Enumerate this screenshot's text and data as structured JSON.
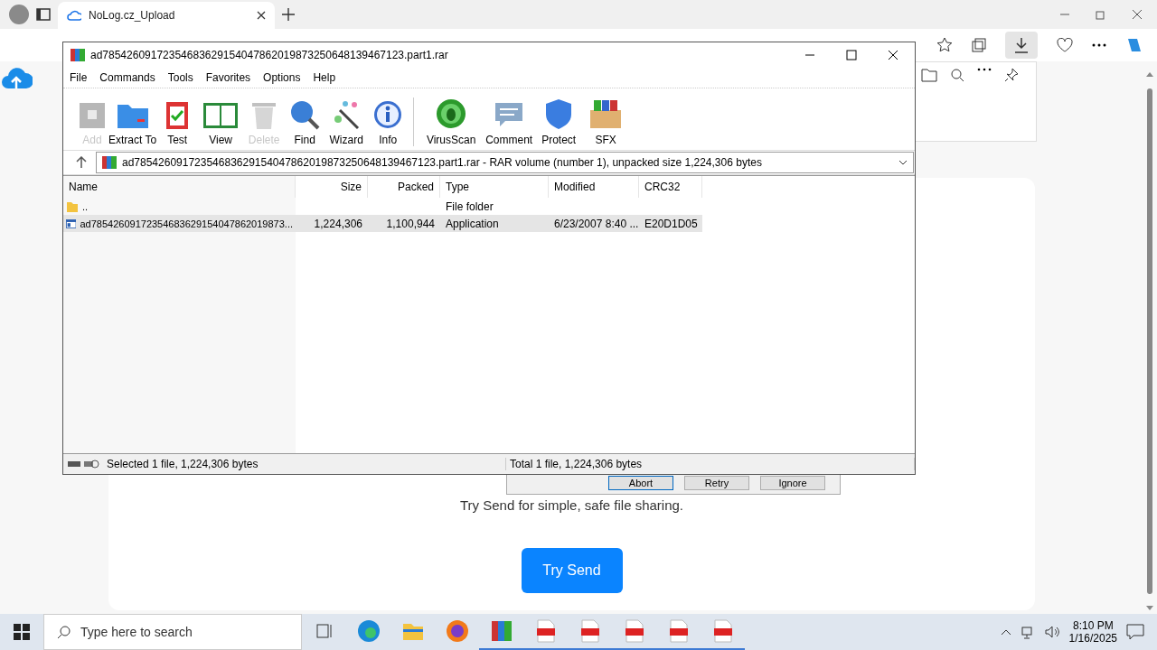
{
  "browser": {
    "tab": {
      "title": "NoLog.cz_Upload"
    },
    "page": {
      "tagline": "Try Send for simple, safe file sharing.",
      "cta": "Try Send"
    },
    "dialog_behind": {
      "buttons": [
        {
          "label": "Abort",
          "selected": true
        },
        {
          "label": "Retry",
          "selected": false
        },
        {
          "label": "Ignore",
          "selected": false
        }
      ]
    }
  },
  "winrar": {
    "title": "ad78542609172354683629154047862019873250648139467123.part1.rar",
    "menu": [
      "File",
      "Commands",
      "Tools",
      "Favorites",
      "Options",
      "Help"
    ],
    "toolbar": [
      {
        "label": "Add",
        "disabled": true
      },
      {
        "label": "Extract To",
        "disabled": false
      },
      {
        "label": "Test",
        "disabled": false
      },
      {
        "label": "View",
        "disabled": false
      },
      {
        "label": "Delete",
        "disabled": true
      },
      {
        "label": "Find",
        "disabled": false
      },
      {
        "label": "Wizard",
        "disabled": false
      },
      {
        "label": "Info",
        "disabled": false
      },
      {
        "label": "VirusScan",
        "disabled": false
      },
      {
        "label": "Comment",
        "disabled": false
      },
      {
        "label": "Protect",
        "disabled": false
      },
      {
        "label": "SFX",
        "disabled": false
      }
    ],
    "path": "ad78542609172354683629154047862019873250648139467123.part1.rar - RAR volume (number 1), unpacked size 1,224,306 bytes",
    "columns": [
      "Name",
      "Size",
      "Packed",
      "Type",
      "Modified",
      "CRC32"
    ],
    "rows": [
      {
        "kind": "folder",
        "selected": false,
        "name": "..",
        "type": "File folder"
      },
      {
        "kind": "file",
        "selected": true,
        "name": "ad78542609172354683629154047862019873...",
        "size": "1,224,306",
        "packed": "1,100,944",
        "type": "Application",
        "modified": "6/23/2007 8:40 ...",
        "crc": "E20D1D05"
      }
    ],
    "status_left": "Selected 1 file, 1,224,306 bytes",
    "status_right": "Total 1 file, 1,224,306 bytes"
  },
  "taskbar": {
    "search_placeholder": "Type here to search",
    "apps": [
      {
        "kind": "edge",
        "running": false
      },
      {
        "kind": "folder",
        "running": false
      },
      {
        "kind": "firefox",
        "running": false
      },
      {
        "kind": "archive",
        "running": true
      },
      {
        "kind": "pdf",
        "running": true
      },
      {
        "kind": "pdf",
        "running": true
      },
      {
        "kind": "pdf",
        "running": true
      },
      {
        "kind": "pdf",
        "running": true
      },
      {
        "kind": "pdf",
        "running": true
      }
    ],
    "time": "8:10 PM",
    "date": "1/16/2025"
  }
}
